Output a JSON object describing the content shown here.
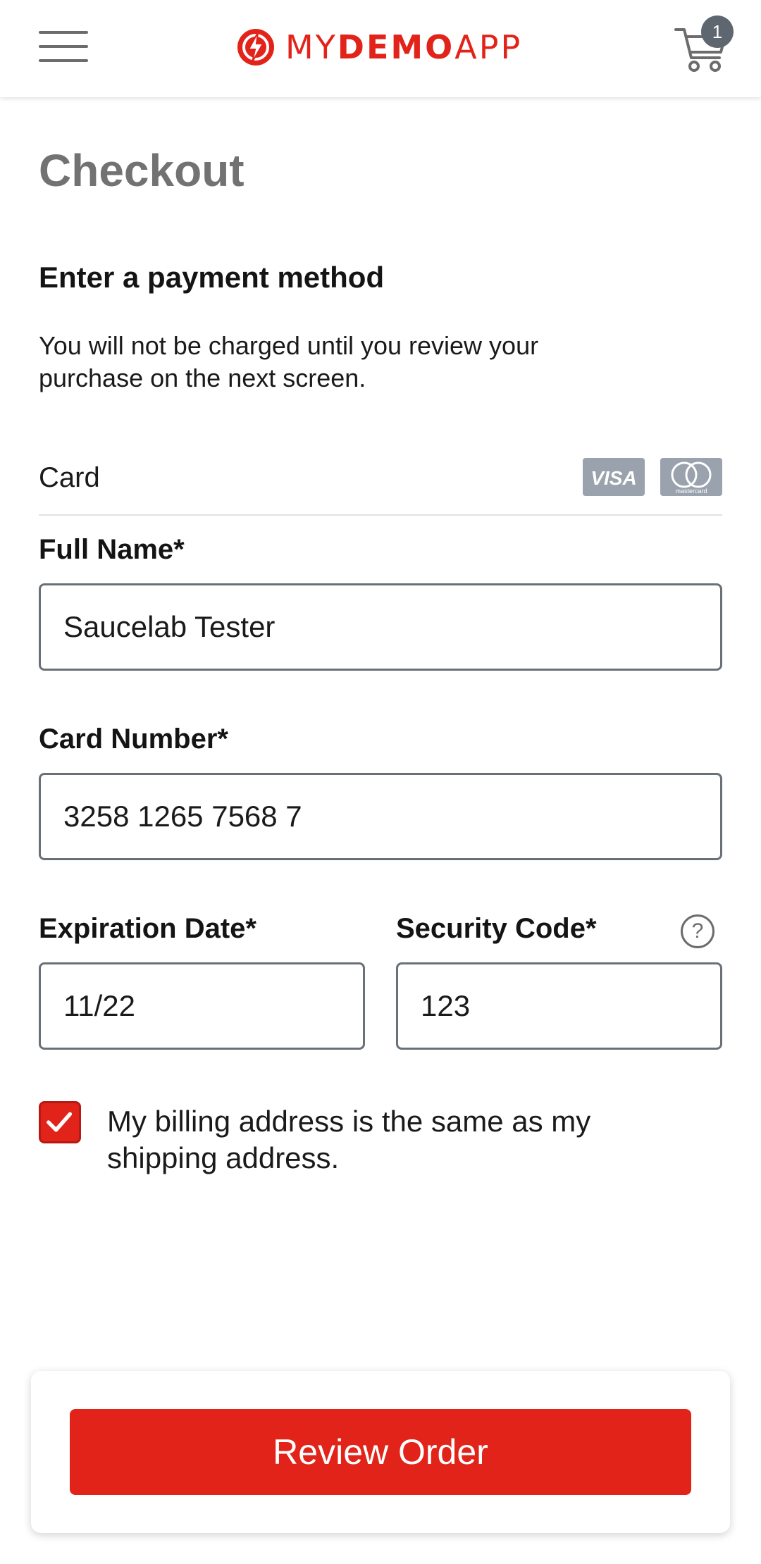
{
  "header": {
    "logo_text_light_1": "MY",
    "logo_text_bold": "DEMO",
    "logo_text_light_2": "APP",
    "cart_count": "1"
  },
  "page_title": "Checkout",
  "section_title": "Enter a payment method",
  "subtitle": "You will not be charged until you review your purchase on the next screen.",
  "card_section": {
    "label": "Card",
    "brand_icons": [
      "visa-icon",
      "mastercard-icon"
    ],
    "visa_text": "VISA",
    "mastercard_text": "mastercard"
  },
  "form": {
    "full_name": {
      "label": "Full Name*",
      "value": "Saucelab Tester"
    },
    "card_number": {
      "label": "Card Number*",
      "value": "3258 1265 7568 7"
    },
    "expiration_date": {
      "label": "Expiration Date*",
      "value": "11/22"
    },
    "security_code": {
      "label": "Security Code*",
      "value": "123",
      "help_icon": "?"
    }
  },
  "billing_same": {
    "checked": true,
    "label": "My billing address is the same as my shipping address."
  },
  "review_button": {
    "label": "Review Order"
  },
  "colors": {
    "brand_red": "#e2231a",
    "title_gray": "#727272",
    "badge_gray": "#5e6670",
    "border_gray": "#6a7078"
  }
}
